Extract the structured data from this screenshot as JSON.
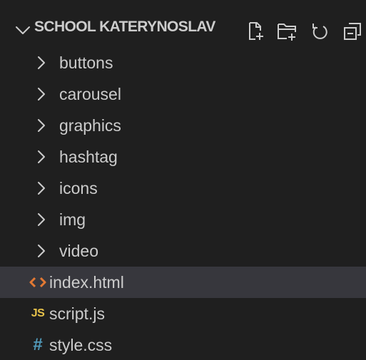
{
  "explorer": {
    "title": "SCHOOL KATERYNOSLAV",
    "actions": [
      {
        "name": "new-file-icon"
      },
      {
        "name": "new-folder-icon"
      },
      {
        "name": "refresh-icon"
      },
      {
        "name": "collapse-all-icon"
      }
    ]
  },
  "tree": {
    "folders": [
      {
        "label": "buttons"
      },
      {
        "label": "carousel"
      },
      {
        "label": "graphics"
      },
      {
        "label": "hashtag"
      },
      {
        "label": "icons"
      },
      {
        "label": "img"
      },
      {
        "label": "video"
      }
    ],
    "files": [
      {
        "label": "index.html",
        "icon": "html-file-icon",
        "selected": true
      },
      {
        "label": "script.js",
        "icon": "js-file-icon",
        "badge": "JS"
      },
      {
        "label": "style.css",
        "icon": "css-file-icon",
        "badge": "#"
      }
    ]
  },
  "colors": {
    "background": "#1f1f1f",
    "selected_row": "#37373d",
    "text": "#cccccc",
    "html_icon": "#e37933",
    "js_icon": "#e8c34a",
    "css_icon": "#519aba"
  }
}
